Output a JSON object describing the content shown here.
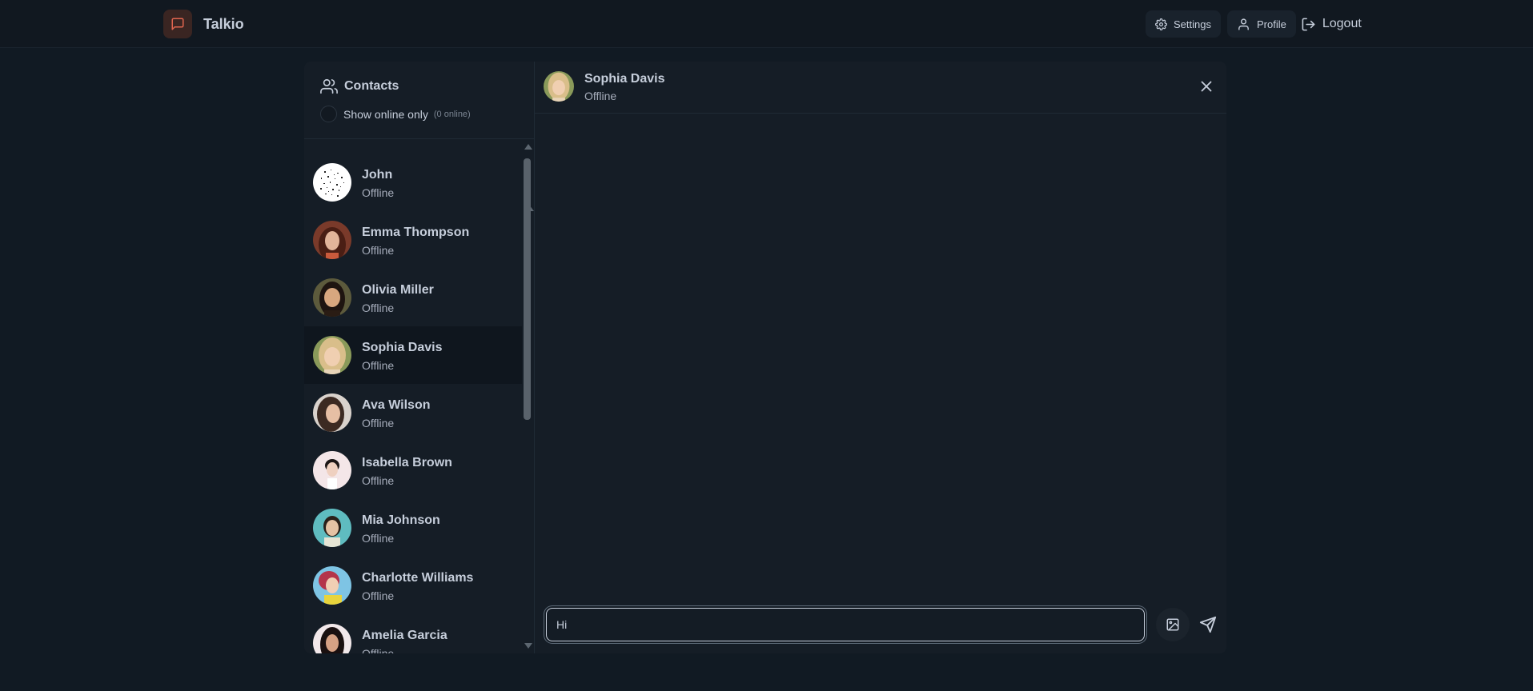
{
  "app": {
    "name": "Talkio"
  },
  "nav": {
    "settings_label": "Settings",
    "profile_label": "Profile",
    "logout_label": "Logout"
  },
  "sidebar": {
    "title": "Contacts",
    "filter_label": "Show online only",
    "online_count": "(0 online)",
    "contacts": [
      {
        "name": "John",
        "status": "Offline",
        "avatar": "noise"
      },
      {
        "name": "Emma Thompson",
        "status": "Offline",
        "avatar": "photo"
      },
      {
        "name": "Olivia Miller",
        "status": "Offline",
        "avatar": "photo"
      },
      {
        "name": "Sophia Davis",
        "status": "Offline",
        "avatar": "photo",
        "selected": true
      },
      {
        "name": "Ava Wilson",
        "status": "Offline",
        "avatar": "photo"
      },
      {
        "name": "Isabella Brown",
        "status": "Offline",
        "avatar": "photo"
      },
      {
        "name": "Mia Johnson",
        "status": "Offline",
        "avatar": "photo"
      },
      {
        "name": "Charlotte Williams",
        "status": "Offline",
        "avatar": "photo"
      },
      {
        "name": "Amelia Garcia",
        "status": "Offline",
        "avatar": "photo"
      }
    ]
  },
  "chat": {
    "name": "Sophia Davis",
    "status": "Offline",
    "input_value": "Hi"
  },
  "colors": {
    "accent": "#e0654f",
    "background": "#111a23",
    "panel": "#151d26",
    "text": "#c6cedb"
  },
  "icons": {
    "brand": "message-square-icon",
    "settings": "gear-icon",
    "profile": "user-icon",
    "logout": "logout-icon",
    "contacts": "users-icon",
    "close": "close-icon",
    "image": "image-icon",
    "send": "send-icon"
  }
}
